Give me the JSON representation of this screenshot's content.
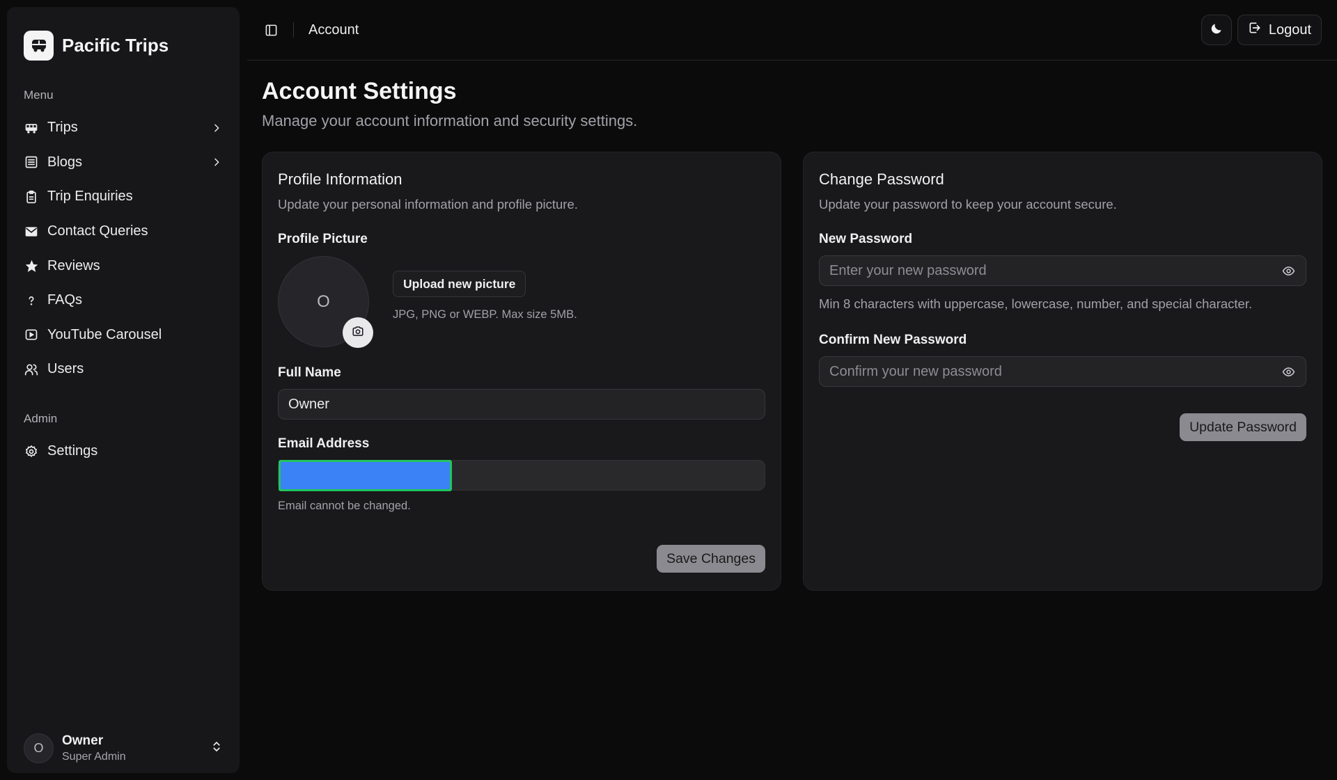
{
  "app": {
    "name": "Pacific Trips",
    "logo_icon": "bus-icon"
  },
  "sidebar": {
    "menu_label": "Menu",
    "admin_label": "Admin",
    "items": [
      {
        "label": "Trips",
        "icon": "bus-icon",
        "has_chevron": true
      },
      {
        "label": "Blogs",
        "icon": "list-icon",
        "has_chevron": true
      },
      {
        "label": "Trip Enquiries",
        "icon": "clipboard-icon",
        "has_chevron": false
      },
      {
        "label": "Contact Queries",
        "icon": "mail-icon",
        "has_chevron": false
      },
      {
        "label": "Reviews",
        "icon": "star-icon",
        "has_chevron": false
      },
      {
        "label": "FAQs",
        "icon": "question-icon",
        "has_chevron": false
      },
      {
        "label": "YouTube Carousel",
        "icon": "play-square-icon",
        "has_chevron": false
      },
      {
        "label": "Users",
        "icon": "users-icon",
        "has_chevron": false
      }
    ],
    "admin_items": [
      {
        "label": "Settings",
        "icon": "gear-icon"
      }
    ],
    "footer": {
      "avatar_initial": "O",
      "name": "Owner",
      "role": "Super Admin"
    }
  },
  "topbar": {
    "breadcrumb": "Account",
    "logout_label": "Logout"
  },
  "page": {
    "title": "Account Settings",
    "subtitle": "Manage your account information and security settings."
  },
  "profile_card": {
    "title": "Profile Information",
    "subtitle": "Update your personal information and profile picture.",
    "picture_label": "Profile Picture",
    "avatar_initial": "O",
    "upload_label": "Upload new picture",
    "upload_hint": "JPG, PNG or WEBP. Max size 5MB.",
    "full_name_label": "Full Name",
    "full_name_value": "Owner",
    "email_label": "Email Address",
    "email_helper": "Email cannot be changed.",
    "save_label": "Save Changes"
  },
  "password_card": {
    "title": "Change Password",
    "subtitle": "Update your password to keep your account secure.",
    "new_label": "New Password",
    "new_placeholder": "Enter your new password",
    "new_hint": "Min 8 characters with uppercase, lowercase, number, and special character.",
    "confirm_label": "Confirm New Password",
    "confirm_placeholder": "Confirm your new password",
    "update_label": "Update Password"
  },
  "colors": {
    "background": "#0b0b0c",
    "sidebar": "#171719",
    "card": "#19191b",
    "redaction_fill": "#3b82f6",
    "redaction_border": "#22c55e",
    "button_disabled": "#8a8a90"
  }
}
